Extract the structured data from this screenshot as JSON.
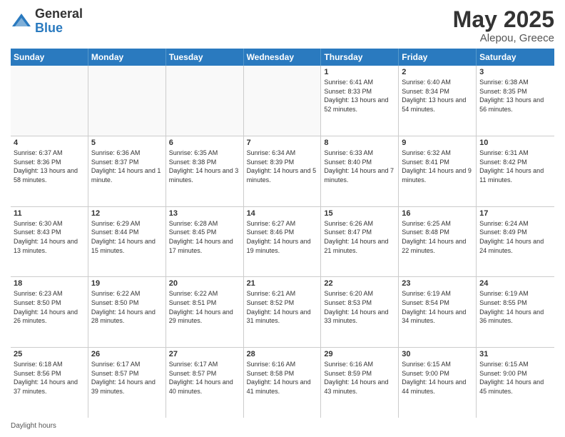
{
  "header": {
    "logo_general": "General",
    "logo_blue": "Blue",
    "title": "May 2025",
    "location": "Alepou, Greece"
  },
  "days_of_week": [
    "Sunday",
    "Monday",
    "Tuesday",
    "Wednesday",
    "Thursday",
    "Friday",
    "Saturday"
  ],
  "weeks": [
    [
      {
        "num": "",
        "detail": "",
        "empty": true
      },
      {
        "num": "",
        "detail": "",
        "empty": true
      },
      {
        "num": "",
        "detail": "",
        "empty": true
      },
      {
        "num": "",
        "detail": "",
        "empty": true
      },
      {
        "num": "1",
        "detail": "Sunrise: 6:41 AM\nSunset: 8:33 PM\nDaylight: 13 hours\nand 52 minutes."
      },
      {
        "num": "2",
        "detail": "Sunrise: 6:40 AM\nSunset: 8:34 PM\nDaylight: 13 hours\nand 54 minutes."
      },
      {
        "num": "3",
        "detail": "Sunrise: 6:38 AM\nSunset: 8:35 PM\nDaylight: 13 hours\nand 56 minutes."
      }
    ],
    [
      {
        "num": "4",
        "detail": "Sunrise: 6:37 AM\nSunset: 8:36 PM\nDaylight: 13 hours\nand 58 minutes."
      },
      {
        "num": "5",
        "detail": "Sunrise: 6:36 AM\nSunset: 8:37 PM\nDaylight: 14 hours\nand 1 minute."
      },
      {
        "num": "6",
        "detail": "Sunrise: 6:35 AM\nSunset: 8:38 PM\nDaylight: 14 hours\nand 3 minutes."
      },
      {
        "num": "7",
        "detail": "Sunrise: 6:34 AM\nSunset: 8:39 PM\nDaylight: 14 hours\nand 5 minutes."
      },
      {
        "num": "8",
        "detail": "Sunrise: 6:33 AM\nSunset: 8:40 PM\nDaylight: 14 hours\nand 7 minutes."
      },
      {
        "num": "9",
        "detail": "Sunrise: 6:32 AM\nSunset: 8:41 PM\nDaylight: 14 hours\nand 9 minutes."
      },
      {
        "num": "10",
        "detail": "Sunrise: 6:31 AM\nSunset: 8:42 PM\nDaylight: 14 hours\nand 11 minutes."
      }
    ],
    [
      {
        "num": "11",
        "detail": "Sunrise: 6:30 AM\nSunset: 8:43 PM\nDaylight: 14 hours\nand 13 minutes."
      },
      {
        "num": "12",
        "detail": "Sunrise: 6:29 AM\nSunset: 8:44 PM\nDaylight: 14 hours\nand 15 minutes."
      },
      {
        "num": "13",
        "detail": "Sunrise: 6:28 AM\nSunset: 8:45 PM\nDaylight: 14 hours\nand 17 minutes."
      },
      {
        "num": "14",
        "detail": "Sunrise: 6:27 AM\nSunset: 8:46 PM\nDaylight: 14 hours\nand 19 minutes."
      },
      {
        "num": "15",
        "detail": "Sunrise: 6:26 AM\nSunset: 8:47 PM\nDaylight: 14 hours\nand 21 minutes."
      },
      {
        "num": "16",
        "detail": "Sunrise: 6:25 AM\nSunset: 8:48 PM\nDaylight: 14 hours\nand 22 minutes."
      },
      {
        "num": "17",
        "detail": "Sunrise: 6:24 AM\nSunset: 8:49 PM\nDaylight: 14 hours\nand 24 minutes."
      }
    ],
    [
      {
        "num": "18",
        "detail": "Sunrise: 6:23 AM\nSunset: 8:50 PM\nDaylight: 14 hours\nand 26 minutes."
      },
      {
        "num": "19",
        "detail": "Sunrise: 6:22 AM\nSunset: 8:50 PM\nDaylight: 14 hours\nand 28 minutes."
      },
      {
        "num": "20",
        "detail": "Sunrise: 6:22 AM\nSunset: 8:51 PM\nDaylight: 14 hours\nand 29 minutes."
      },
      {
        "num": "21",
        "detail": "Sunrise: 6:21 AM\nSunset: 8:52 PM\nDaylight: 14 hours\nand 31 minutes."
      },
      {
        "num": "22",
        "detail": "Sunrise: 6:20 AM\nSunset: 8:53 PM\nDaylight: 14 hours\nand 33 minutes."
      },
      {
        "num": "23",
        "detail": "Sunrise: 6:19 AM\nSunset: 8:54 PM\nDaylight: 14 hours\nand 34 minutes."
      },
      {
        "num": "24",
        "detail": "Sunrise: 6:19 AM\nSunset: 8:55 PM\nDaylight: 14 hours\nand 36 minutes."
      }
    ],
    [
      {
        "num": "25",
        "detail": "Sunrise: 6:18 AM\nSunset: 8:56 PM\nDaylight: 14 hours\nand 37 minutes."
      },
      {
        "num": "26",
        "detail": "Sunrise: 6:17 AM\nSunset: 8:57 PM\nDaylight: 14 hours\nand 39 minutes."
      },
      {
        "num": "27",
        "detail": "Sunrise: 6:17 AM\nSunset: 8:57 PM\nDaylight: 14 hours\nand 40 minutes."
      },
      {
        "num": "28",
        "detail": "Sunrise: 6:16 AM\nSunset: 8:58 PM\nDaylight: 14 hours\nand 41 minutes."
      },
      {
        "num": "29",
        "detail": "Sunrise: 6:16 AM\nSunset: 8:59 PM\nDaylight: 14 hours\nand 43 minutes."
      },
      {
        "num": "30",
        "detail": "Sunrise: 6:15 AM\nSunset: 9:00 PM\nDaylight: 14 hours\nand 44 minutes."
      },
      {
        "num": "31",
        "detail": "Sunrise: 6:15 AM\nSunset: 9:00 PM\nDaylight: 14 hours\nand 45 minutes."
      }
    ]
  ],
  "footer": "Daylight hours"
}
